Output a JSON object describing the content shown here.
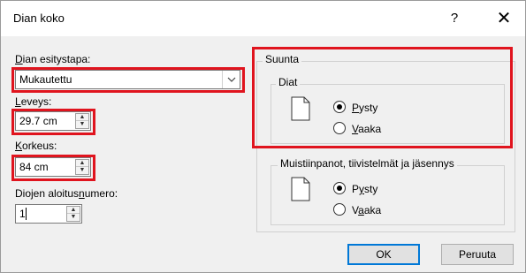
{
  "dialog": {
    "title": "Dian koko",
    "help_label": "?",
    "close_label": "✕"
  },
  "left": {
    "format_label_mnemonic": "D",
    "format_label_rest": "ian esitystapa:",
    "format_value": "Mukautettu",
    "width_label_mnemonic": "L",
    "width_label_rest": "eveys:",
    "width_value": "29.7 cm",
    "height_label_mnemonic": "K",
    "height_label_rest": "orkeus:",
    "height_value": "84 cm",
    "start_label_pre": "Diojen aloitus",
    "start_label_mnemonic": "n",
    "start_label_post": "umero:",
    "start_value": "1"
  },
  "orientation": {
    "group_label": "Suunta",
    "slides_label": "Diat",
    "slides_portrait_mnemonic": "P",
    "slides_portrait_rest": "ysty",
    "slides_landscape_mnemonic": "V",
    "slides_landscape_rest": "aaka",
    "slides_selected": "portrait",
    "notes_label": "Muistiinpanot, tiivistelmät ja jäsennys",
    "notes_portrait_pre": "P",
    "notes_portrait_mnemonic": "y",
    "notes_portrait_post": "sty",
    "notes_landscape_pre": "V",
    "notes_landscape_mnemonic": "a",
    "notes_landscape_post": "aka",
    "notes_selected": "portrait"
  },
  "buttons": {
    "ok": "OK",
    "cancel": "Peruuta"
  },
  "colors": {
    "highlight": "#e0141e",
    "default_button_border": "#0078d7"
  }
}
